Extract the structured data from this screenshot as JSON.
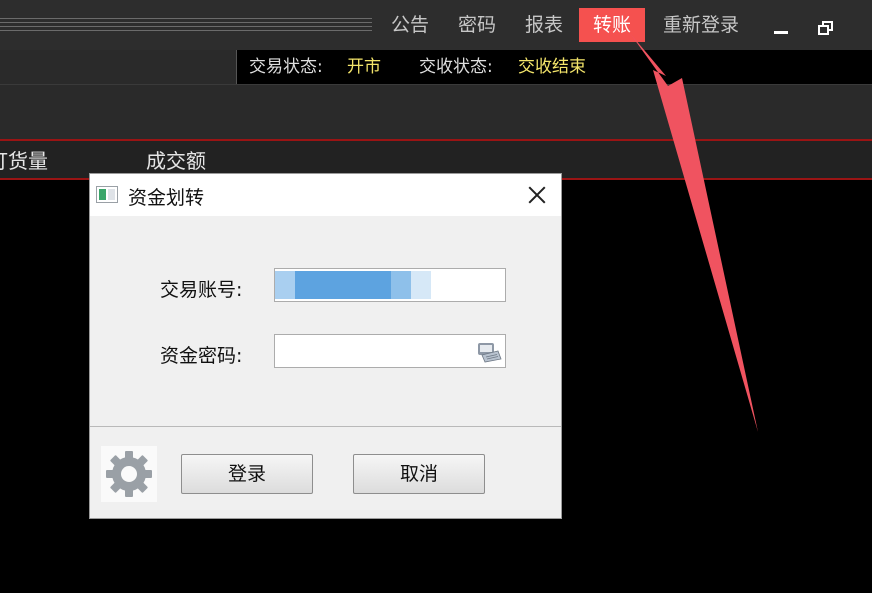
{
  "menu": {
    "items": [
      {
        "label": "公告",
        "active": false
      },
      {
        "label": "密码",
        "active": false
      },
      {
        "label": "报表",
        "active": false
      },
      {
        "label": "转账",
        "active": true
      },
      {
        "label": "重新登录",
        "active": false
      }
    ],
    "active_color": "#f5514f"
  },
  "status": {
    "trade_label": "交易状态:",
    "trade_value": "开市",
    "settle_label": "交收状态:",
    "settle_value": "交收结束"
  },
  "table": {
    "headers": [
      "订货量",
      "成交额"
    ]
  },
  "dialog": {
    "title": "资金划转",
    "account_label": "交易账号:",
    "password_label": "资金密码:",
    "password_value": "",
    "login_button": "登录",
    "cancel_button": "取消"
  },
  "icons": [
    "app-icon",
    "close-icon",
    "keyboard-icon",
    "gear-icon",
    "minimize-icon",
    "restore-icon"
  ],
  "colors": {
    "status_value": "#f3e46a",
    "annotation_arrow": "#f05360",
    "table_border": "#9a1414"
  }
}
